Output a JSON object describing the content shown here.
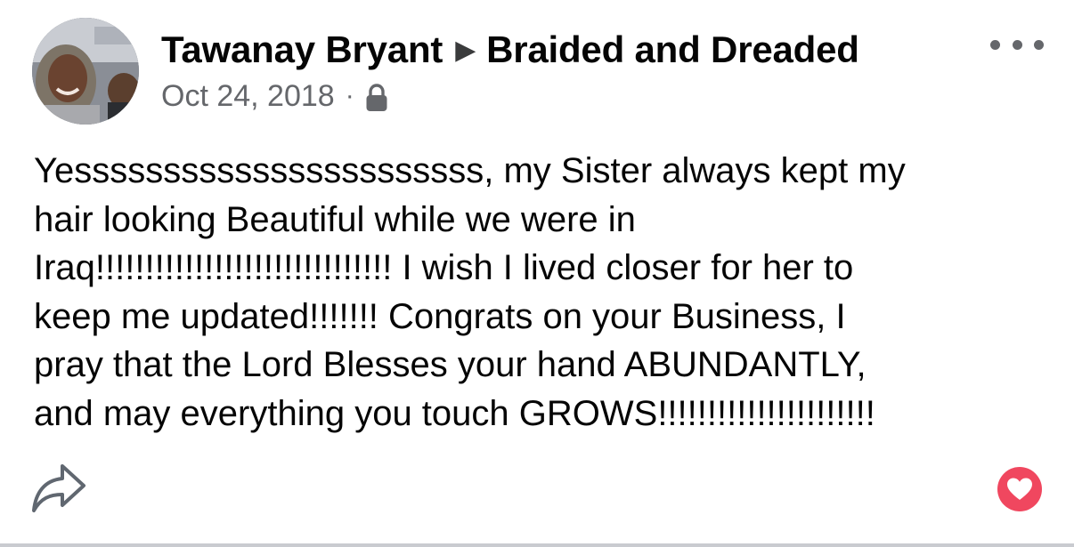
{
  "post": {
    "author": "Tawanay Bryant",
    "separator": "▶",
    "group": "Braided and Dreaded",
    "date": "Oct 24, 2018",
    "meta_dot": "·",
    "privacy_icon": "lock-icon",
    "more_icon": "more-options-icon",
    "body_lines": [
      "Yesssssssssssssssssssssss, my Sister always kept my",
      "hair looking Beautiful while we were in",
      "Iraq!!!!!!!!!!!!!!!!!!!!!!!!!!!!!! I wish I lived closer for her to",
      "keep me updated!!!!!!! Congrats on your Business, I",
      "pray that the Lord Blesses your hand ABUNDANTLY,",
      "and may everything you touch GROWS!!!!!!!!!!!!!!!!!!!!!!"
    ]
  },
  "actions": {
    "share_icon": "share-arrow-icon",
    "reaction_icon": "heart-icon",
    "reaction_color": "#f0475f"
  },
  "colors": {
    "text": "#050505",
    "secondary_text": "#65676b",
    "divider": "#c9cbd0"
  }
}
